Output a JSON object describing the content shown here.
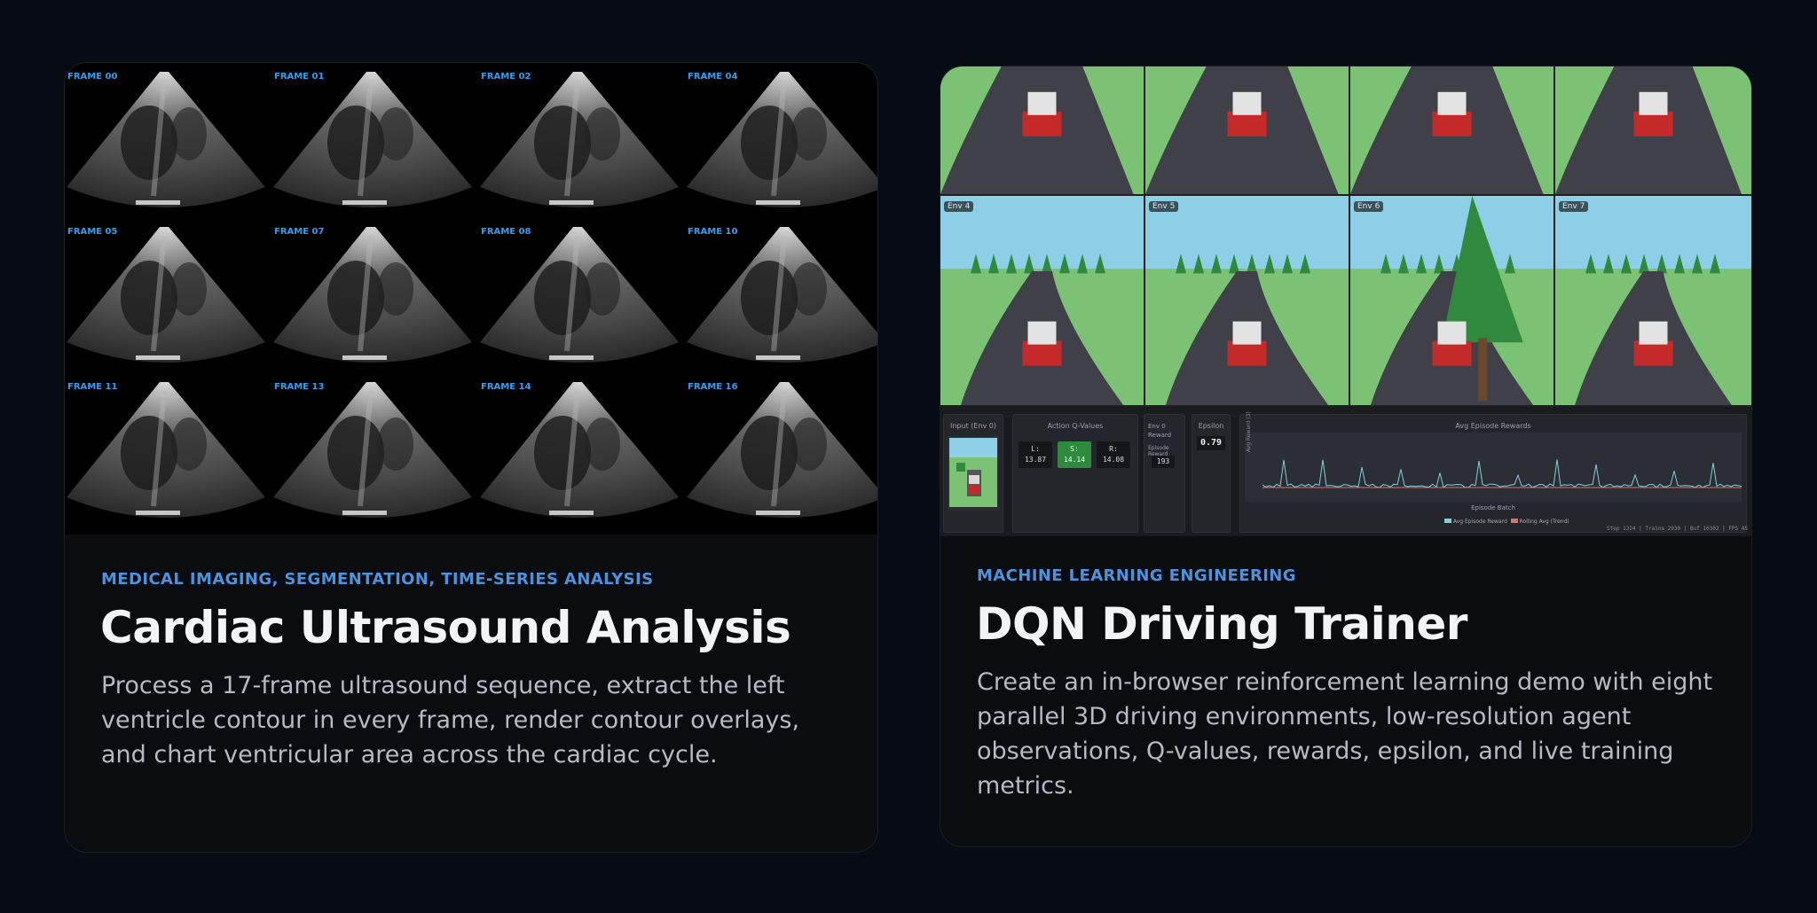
{
  "cards": [
    {
      "tag": "MEDICAL IMAGING, SEGMENTATION, TIME-SERIES ANALYSIS",
      "title": "Cardiac Ultrasound Analysis",
      "description": "Process a 17-frame ultrasound sequence, extract the left ventricle contour in every frame, render contour overlays, and chart ventricular area across the cardiac cycle.",
      "frames": [
        "FRAME 00",
        "FRAME 01",
        "FRAME 02",
        "FRAME 04",
        "FRAME 05",
        "FRAME 07",
        "FRAME 08",
        "FRAME 10",
        "FRAME 11",
        "FRAME 13",
        "FRAME 14",
        "FRAME 16"
      ]
    },
    {
      "tag": "MACHINE LEARNING ENGINEERING",
      "title": "DQN Driving Trainer",
      "description": "Create an in-browser reinforcement learning demo with eight parallel 3D driving environments, low-resolution agent observations, Q-values, rewards, epsilon, and live training metrics.",
      "envs": [
        "Env 4",
        "Env 5",
        "Env 6",
        "Env 7"
      ],
      "panels": {
        "input_title": "Input (Env 0)",
        "q_title": "Action Q-Values",
        "q_values": [
          {
            "label": "L:",
            "value": "13.87",
            "active": false
          },
          {
            "label": "S:",
            "value": "14.14",
            "active": true
          },
          {
            "label": "R:",
            "value": "14.08",
            "active": false
          }
        ],
        "reward_title": "Env 0 Reward",
        "episode_reward_label": "Episode Reward",
        "episode_reward_value": "193",
        "epsilon_title": "Epsilon",
        "epsilon_value": "0.79",
        "chart_title": "Avg Episode Rewards",
        "chart_xlabel": "Episode Batch",
        "chart_ylabel": "Avg Reward (3)",
        "legend": [
          "Avg Episode Reward",
          "Rolling Avg (Trend)"
        ],
        "status": "Step 1324 | Trains 2930 | Buf 10302 | FPS 45"
      },
      "colors": {
        "grass": "#7cc275",
        "sky": "#8ecfe8",
        "road": "#404148",
        "car_body": "#c52a2a",
        "car_top": "#e3e3e3",
        "tree": "#2f8a3e",
        "trunk": "#6b4a2b"
      }
    }
  ]
}
